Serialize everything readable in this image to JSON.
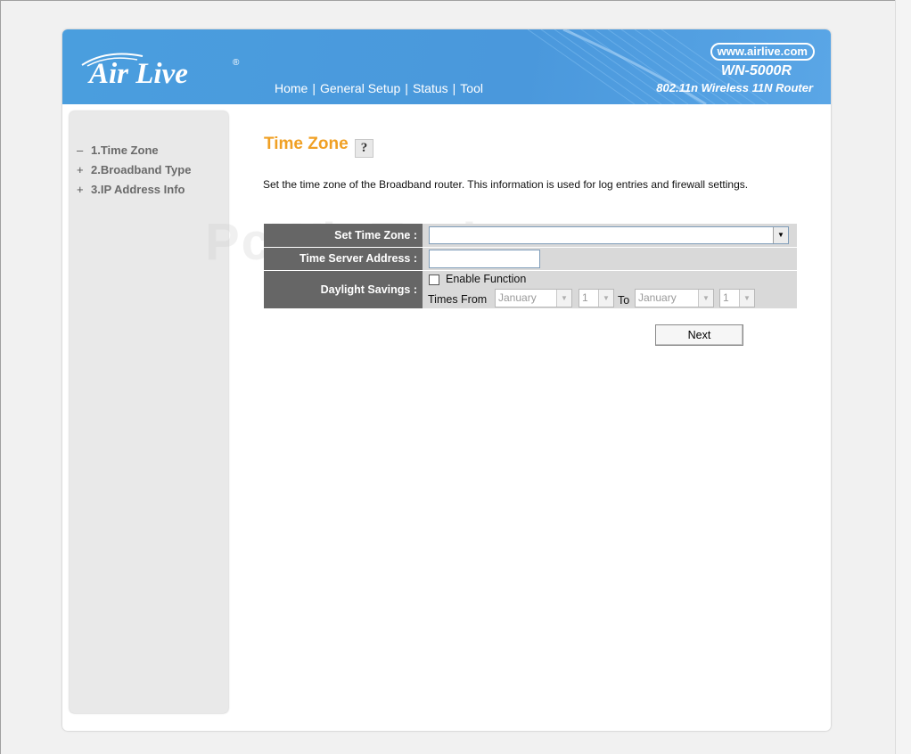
{
  "header": {
    "logo_text": "Air Live",
    "logo_reg": "®",
    "url_badge": "www.airlive.com",
    "model": "WN-5000R",
    "model_desc": "802.11n Wireless 11N Router",
    "nav": [
      {
        "label": "Home"
      },
      {
        "label": "General Setup"
      },
      {
        "label": "Status"
      },
      {
        "label": "Tool"
      }
    ],
    "nav_separator": "|"
  },
  "sidebar": {
    "items": [
      {
        "mark": "–",
        "label": "1.Time Zone"
      },
      {
        "mark": "+",
        "label": "2.Broadband Type"
      },
      {
        "mark": "+",
        "label": "3.IP Address Info"
      }
    ]
  },
  "content": {
    "title": "Time Zone",
    "help_glyph": "?",
    "description": "Set the time zone of the Broadband router. This information is used for log entries and firewall settings.",
    "watermark": "PcWinTech.com",
    "form": {
      "set_time_zone_label": "Set Time Zone :",
      "time_zone_value": "",
      "time_server_label": "Time Server Address :",
      "time_server_value": "",
      "daylight_label": "Daylight Savings :",
      "enable_function_label": "Enable Function",
      "enable_function_checked": false,
      "times_from_label": "Times From",
      "from_month": "January",
      "from_day": "1",
      "to_label": "To",
      "to_month": "January",
      "to_day": "1"
    },
    "next_label": "Next"
  },
  "colors": {
    "header_blue": "#4a9ede",
    "title_orange": "#f0a024",
    "label_bg": "#666666",
    "sidebar_bg": "#e9e9e9"
  },
  "icons": {
    "dropdown": "triangle-down",
    "help": "question-mark-icon"
  }
}
